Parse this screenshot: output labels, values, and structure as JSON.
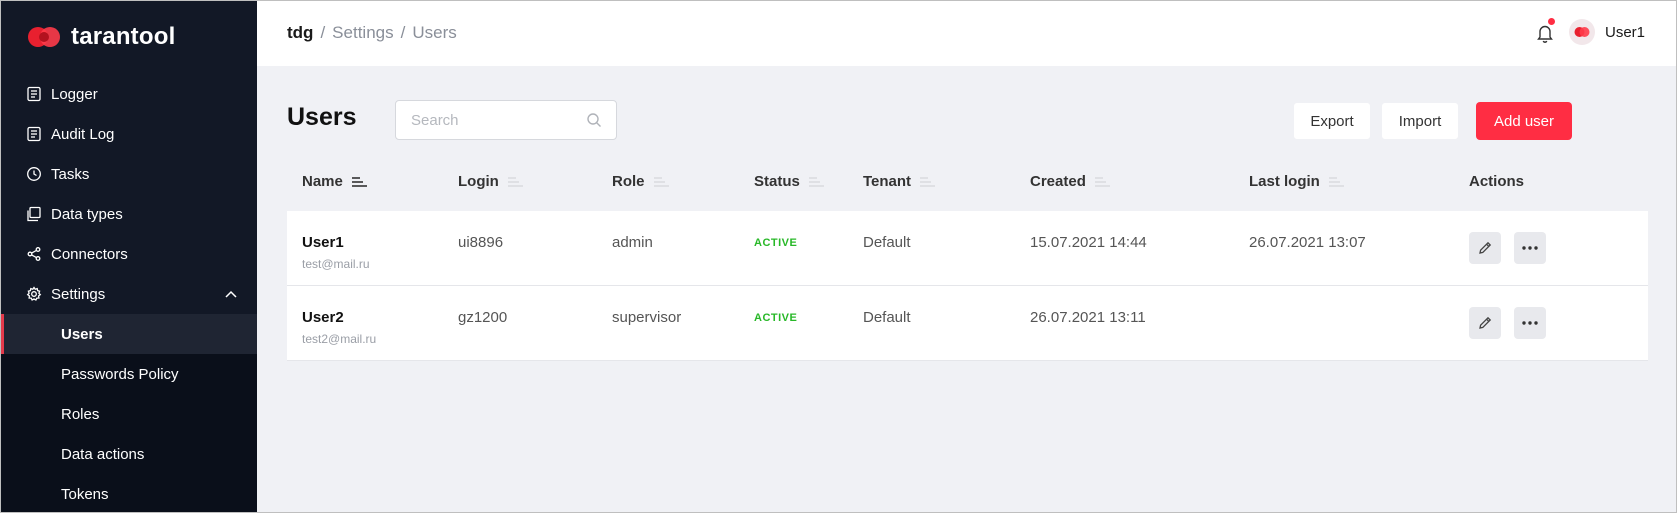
{
  "app": {
    "logo_text": "tarantool"
  },
  "sidebar": {
    "items": [
      {
        "label": "Logger",
        "icon": "document-icon"
      },
      {
        "label": "Audit Log",
        "icon": "document-icon"
      },
      {
        "label": "Tasks",
        "icon": "clock-icon"
      },
      {
        "label": "Data types",
        "icon": "layers-icon"
      },
      {
        "label": "Connectors",
        "icon": "share-icon"
      },
      {
        "label": "Settings",
        "icon": "gear-icon",
        "expanded": true
      }
    ],
    "settings_children": [
      {
        "label": "Users",
        "active": true
      },
      {
        "label": "Passwords Policy"
      },
      {
        "label": "Roles"
      },
      {
        "label": "Data actions"
      },
      {
        "label": "Tokens"
      }
    ]
  },
  "header": {
    "breadcrumb": {
      "root": "tdg",
      "sep": "/",
      "level1": "Settings",
      "level2": "Users"
    },
    "user_name": "User1",
    "has_notification": true
  },
  "page": {
    "title": "Users",
    "search_placeholder": "Search",
    "export_label": "Export",
    "import_label": "Import",
    "add_user_label": "Add user"
  },
  "table": {
    "columns": [
      "Name",
      "Login",
      "Role",
      "Status",
      "Tenant",
      "Created",
      "Last login",
      "Actions"
    ],
    "rows": [
      {
        "name": "User1",
        "email": "test@mail.ru",
        "login": "ui8896",
        "role": "admin",
        "status": "ACTIVE",
        "tenant": "Default",
        "created": "15.07.2021 14:44",
        "last_login": "26.07.2021 13:07"
      },
      {
        "name": "User2",
        "email": "test2@mail.ru",
        "login": "gz1200",
        "role": "supervisor",
        "status": "ACTIVE",
        "tenant": "Default",
        "created": "26.07.2021 13:11",
        "last_login": ""
      }
    ]
  },
  "colors": {
    "accent": "#ff2d43",
    "sidebar_bg": "#121826",
    "status_active": "#28b828"
  }
}
